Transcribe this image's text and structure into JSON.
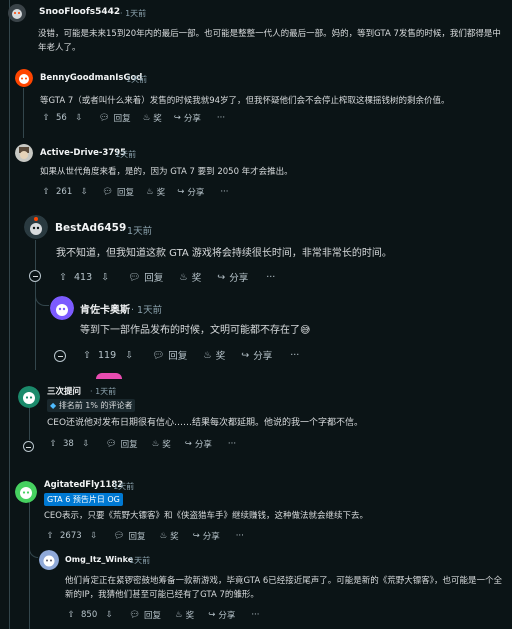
{
  "comments": [
    {
      "username": "SnooFloofs5442",
      "time": "1天前",
      "body": "没错，可能是未来15到20年内的最后一部。也可能是整整一代人的最后一部。妈的，等到GTA 7发售的时候，我们都得是中年老人了。"
    },
    {
      "username": "BennyGoodmanIsGod",
      "time": "1天前",
      "body": "等GTA 7（或者叫什么来着）发售的时候我就94岁了，但我怀疑他们会不会停止榨取这棵摇钱树的剩余价值。",
      "votes": "56",
      "reply": "回复",
      "award": "奖",
      "share": "分享",
      "more": "···"
    },
    {
      "username": "Active-Drive-3795",
      "time": "1天前",
      "body": "如果从世代角度来看，是的，因为 GTA 7 要到 2050 年才会推出。",
      "votes": "261",
      "reply": "回复",
      "award": "奖",
      "share": "分享",
      "more": "···"
    },
    {
      "username": "BestAd6459",
      "time": "1天前",
      "body": "我不知道，但我知道这款 GTA 游戏将会持续很长时间，非常非常长的时间。",
      "votes": "413",
      "reply": "回复",
      "award": "奖",
      "share": "分享",
      "more": "···"
    },
    {
      "username": "肯佐卡奥斯",
      "time": "1天前",
      "body": "等到下一部作品发布的时候，文明可能都不存在了😅",
      "votes": "119",
      "reply": "回复",
      "award": "奖",
      "share": "分享",
      "more": "···"
    },
    {
      "username": "三次提问",
      "time": "1天前",
      "flair": "排名前 1% 的评论者",
      "body": "CEO还说他对发布日期很有信心……结果每次都延期。他说的我一个字都不信。",
      "votes": "38",
      "reply": "回复",
      "award": "奖",
      "share": "分享",
      "more": "···"
    },
    {
      "username": "AgitatedFly1182",
      "time": "1天前",
      "flair": "GTA 6 预告片日 OG",
      "body": "CEO表示，只要《荒野大镖客》和《侠盗猎车手》继续赚钱，这种做法就会继续下去。",
      "votes": "2673",
      "reply": "回复",
      "award": "奖",
      "share": "分享",
      "more": "···"
    },
    {
      "username": "Omg_Itz_Winke",
      "time": "1天前",
      "body": "他们肯定正在紧锣密鼓地筹备一款新游戏，毕竟GTA 6已经接近尾声了。可能是新的《荒野大镖客》，也可能是一个全新的IP，我猜他们甚至可能已经有了GTA 7的雏形。",
      "votes": "850",
      "reply": "回复",
      "award": "奖",
      "share": "分享",
      "more": "···"
    }
  ],
  "icons": {
    "upvote": "arrow-up-outline",
    "downvote": "arrow-down-outline",
    "reply": "speech-bubble",
    "award": "award-ribbon",
    "share": "share-arrow",
    "collapse": "circle-minus"
  },
  "colors": {
    "background": "#0b1416",
    "username": "#f2f4f5",
    "meta": "#8ba2ad",
    "flair_blue": "#0079d3",
    "thread_line": "#33464c"
  }
}
